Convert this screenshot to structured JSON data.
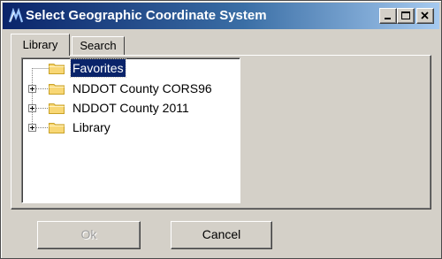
{
  "window": {
    "title": "Select Geographic Coordinate System"
  },
  "tabs": [
    {
      "label": "Library",
      "active": true
    },
    {
      "label": "Search",
      "active": false
    }
  ],
  "tree": {
    "items": [
      {
        "label": "Favorites",
        "expandable": false,
        "selected": true,
        "icon": "folder-icon"
      },
      {
        "label": "NDDOT County CORS96",
        "expandable": true,
        "selected": false,
        "icon": "folder-icon"
      },
      {
        "label": "NDDOT County 2011",
        "expandable": true,
        "selected": false,
        "icon": "folder-icon"
      },
      {
        "label": "Library",
        "expandable": true,
        "selected": false,
        "icon": "folder-icon"
      }
    ]
  },
  "buttons": {
    "ok": "Ok",
    "cancel": "Cancel"
  },
  "colors": {
    "selection": "#0a246a",
    "titlebar": "#0a246a",
    "face": "#d4d0c8",
    "folder": "#f8d775"
  }
}
